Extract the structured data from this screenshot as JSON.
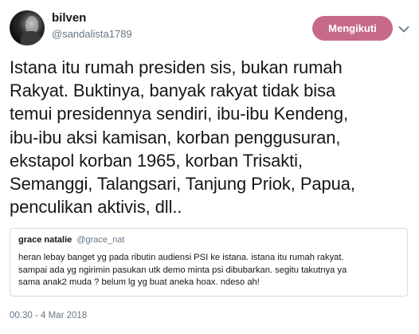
{
  "author": {
    "display_name": "bilven",
    "handle": "@sandalista1789"
  },
  "follow_button": {
    "label": "Mengikuti",
    "color": "#c76a8a"
  },
  "caret_icon": "chevron-down-icon",
  "tweet": {
    "lines": [
      "Istana itu rumah presiden sis, bukan rumah",
      "Rakyat. Buktinya, banyak rakyat tidak bisa",
      "temui presidennya sendiri, ibu-ibu Kendeng,",
      "ibu-ibu aksi kamisan, korban penggusuran,",
      "ekstapol korban 1965, korban Trisakti,",
      "Semanggi, Talangsari, Tanjung Priok, Papua,",
      "penculikan aktivis, dll.."
    ]
  },
  "quoted_tweet": {
    "display_name": "grace natalie",
    "handle": "@grace_nat",
    "lines": [
      "heran lebay banget yg pada ributin audiensi PSI ke istana. istana itu rumah rakyat.",
      "sampai ada yg ngirimin pasukan utk demo minta psi dibubarkan. segitu takutnya ya",
      "sama anak2 muda ? belum lg yg buat aneka hoax. ndeso ah!"
    ]
  },
  "timestamp": "00.30 - 4 Mar 2018"
}
